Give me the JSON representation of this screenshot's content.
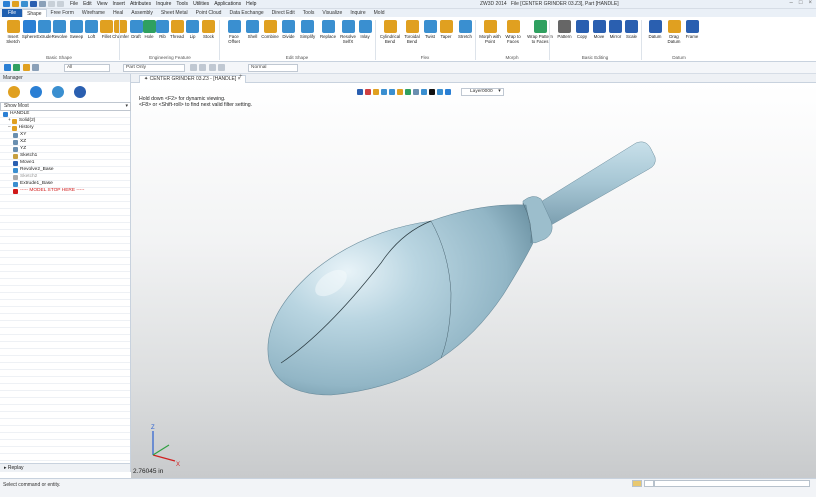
{
  "window": {
    "app_version": "ZW3D 2014",
    "title": "File [CENTER GRINDER 03.Z3], Part [HANDLE]",
    "controls": [
      "–",
      "□",
      "×"
    ]
  },
  "menubar": [
    "File",
    "Edit",
    "View",
    "Insert",
    "Attributes",
    "Inquire",
    "Tools",
    "Utilities",
    "Applications",
    "Help"
  ],
  "ribbon_tabs": [
    {
      "label": "File",
      "kind": "file"
    },
    {
      "label": "Shape",
      "kind": "active"
    },
    {
      "label": "Free Form"
    },
    {
      "label": "Wireframe"
    },
    {
      "label": "Heal"
    },
    {
      "label": "Assembly"
    },
    {
      "label": "Sheet Metal"
    },
    {
      "label": "Point Cloud"
    },
    {
      "label": "Data Exchange"
    },
    {
      "label": "Direct Edit"
    },
    {
      "label": "Tools"
    },
    {
      "label": "Visualize"
    },
    {
      "label": "Inquire"
    },
    {
      "label": "Mold"
    }
  ],
  "ribbon": {
    "buttons": [
      {
        "label": "Insert\nSketch",
        "icon": "sketch-icon",
        "color": "#e0a020"
      },
      {
        "label": "Sphere",
        "icon": "sphere-icon",
        "color": "#2a7fd4"
      },
      {
        "label": "Extrude",
        "icon": "extrude-icon",
        "color": "#3a8fd0"
      },
      {
        "label": "Revolve",
        "icon": "revolve-icon",
        "color": "#3a8fd0"
      },
      {
        "label": "Sweep",
        "icon": "sweep-icon",
        "color": "#3a8fd0"
      },
      {
        "label": "Loft",
        "icon": "loft-icon",
        "color": "#3a8fd0"
      },
      {
        "label": "Fillet",
        "icon": "fillet-icon",
        "color": "#e0a020"
      },
      {
        "label": "Chamfer",
        "icon": "chamfer-icon",
        "color": "#e0a020"
      },
      {
        "label": "Draft",
        "icon": "draft-icon",
        "color": "#3a8fd0"
      },
      {
        "label": "Hole",
        "icon": "hole-icon",
        "color": "#2fa060"
      },
      {
        "label": "Rib",
        "icon": "rib-icon",
        "color": "#3a8fd0"
      },
      {
        "label": "Thread",
        "icon": "thread-icon",
        "color": "#e0a020"
      },
      {
        "label": "Lip",
        "icon": "lip-icon",
        "color": "#3a8fd0"
      },
      {
        "label": "Stock",
        "icon": "stock-icon",
        "color": "#e0a020"
      },
      {
        "label": "Face\nOffset",
        "icon": "face-offset-icon",
        "color": "#3a8fd0"
      },
      {
        "label": "Shell",
        "icon": "shell-icon",
        "color": "#3a8fd0"
      },
      {
        "label": "Combine",
        "icon": "combine-icon",
        "color": "#e0a020"
      },
      {
        "label": "Divide",
        "icon": "divide-icon",
        "color": "#3a8fd0"
      },
      {
        "label": "Simplify",
        "icon": "simplify-icon",
        "color": "#3a8fd0"
      },
      {
        "label": "Replace",
        "icon": "replace-icon",
        "color": "#3a8fd0"
      },
      {
        "label": "Resolve\nSelfX",
        "icon": "resolve-icon",
        "color": "#3a8fd0"
      },
      {
        "label": "Inlay",
        "icon": "inlay-icon",
        "color": "#3a8fd0"
      },
      {
        "label": "Cylindrical\nBend",
        "icon": "cyl-bend-icon",
        "color": "#e0a020"
      },
      {
        "label": "Toroidal\nBend",
        "icon": "tor-bend-icon",
        "color": "#e0a020"
      },
      {
        "label": "Twist",
        "icon": "twist-icon",
        "color": "#3a8fd0"
      },
      {
        "label": "Taper",
        "icon": "taper-icon",
        "color": "#e0a020"
      },
      {
        "label": "Stretch",
        "icon": "stretch-icon",
        "color": "#3a8fd0"
      },
      {
        "label": "Morph with\nPoint",
        "icon": "morph-point-icon",
        "color": "#e0a020"
      },
      {
        "label": "Wrap to\nFaces",
        "icon": "wrap-faces-icon",
        "color": "#e0a020"
      },
      {
        "label": "Wrap Pattern\nto Faces",
        "icon": "wrap-pattern-icon",
        "color": "#2fa060"
      },
      {
        "label": "Pattern",
        "icon": "pattern-icon",
        "color": "#666666"
      },
      {
        "label": "Copy",
        "icon": "copy-icon",
        "color": "#2a5fb0"
      },
      {
        "label": "Move",
        "icon": "move-icon",
        "color": "#2a5fb0"
      },
      {
        "label": "Mirror",
        "icon": "mirror-icon",
        "color": "#2a5fb0"
      },
      {
        "label": "Scale",
        "icon": "scale-icon",
        "color": "#2a5fb0"
      },
      {
        "label": "Datum",
        "icon": "datum-icon",
        "color": "#2a5fb0"
      },
      {
        "label": "Drag\nDatum",
        "icon": "drag-datum-icon",
        "color": "#e0a020"
      },
      {
        "label": "Frame",
        "icon": "frame-icon",
        "color": "#2a5fb0"
      }
    ],
    "groups": [
      "Basic Shape",
      "Engineering Feature",
      "Edit Shape",
      "Flex",
      "Morph",
      "Basic Editing",
      "Datum"
    ]
  },
  "toolbar2": {
    "filter_value": "All",
    "part_only": "Part Only",
    "display_mode": "Normal"
  },
  "manager": {
    "title": "Manager",
    "panel_icons": [
      "history-manager-icon",
      "assembly-manager-icon",
      "view-manager-icon",
      "feature-manager-icon"
    ],
    "show_mode": "Show Most",
    "tree": [
      {
        "label": "HANDLE",
        "icon": "part-icon",
        "color": "#2a7fd4",
        "indent": 0
      },
      {
        "label": "Solid(2)",
        "icon": "solid-icon",
        "color": "#e0a020",
        "indent": 1,
        "expander": "+"
      },
      {
        "label": "History",
        "icon": "history-icon",
        "color": "#e0a020",
        "indent": 1,
        "expander": "–"
      },
      {
        "label": "XY",
        "icon": "plane-icon",
        "color": "#6a8fb0",
        "indent": 2
      },
      {
        "label": "XZ",
        "icon": "plane-icon",
        "color": "#6a8fb0",
        "indent": 2
      },
      {
        "label": "YZ",
        "icon": "plane-icon",
        "color": "#6a8fb0",
        "indent": 2
      },
      {
        "label": "Sketch1",
        "icon": "sketch-icon",
        "color": "#c8a040",
        "indent": 2
      },
      {
        "label": "Move1",
        "icon": "move-icon",
        "color": "#2a5fb0",
        "indent": 2
      },
      {
        "label": "Revolve2_Base",
        "icon": "revolve-icon",
        "color": "#3a8fd0",
        "indent": 2
      },
      {
        "label": "Sketch2",
        "icon": "sketch-icon",
        "color": "#aaaaaa",
        "indent": 2,
        "dim": true
      },
      {
        "label": "Extrude1_Base",
        "icon": "extrude-icon",
        "color": "#3a8fd0",
        "indent": 2
      },
      {
        "label": "----- MODEL STOP HERE -----",
        "icon": "stop-arrow-icon",
        "color": "#d01818",
        "indent": 2,
        "stop": true
      }
    ],
    "replay": "Replay"
  },
  "document_tab": "CENTER GRINDER 03.Z3 - [HANDLE]",
  "viewport": {
    "hint_line1": "Hold down <F2> for dynamic viewing.",
    "hint_line2": "<F8> or <Shift-roll> to find next valid filter setting.",
    "layer": "Layer0000",
    "units_readout": "2.76045 in",
    "model_color": "#a9c7d4"
  },
  "statusbar": {
    "message": "Select command or entity."
  }
}
